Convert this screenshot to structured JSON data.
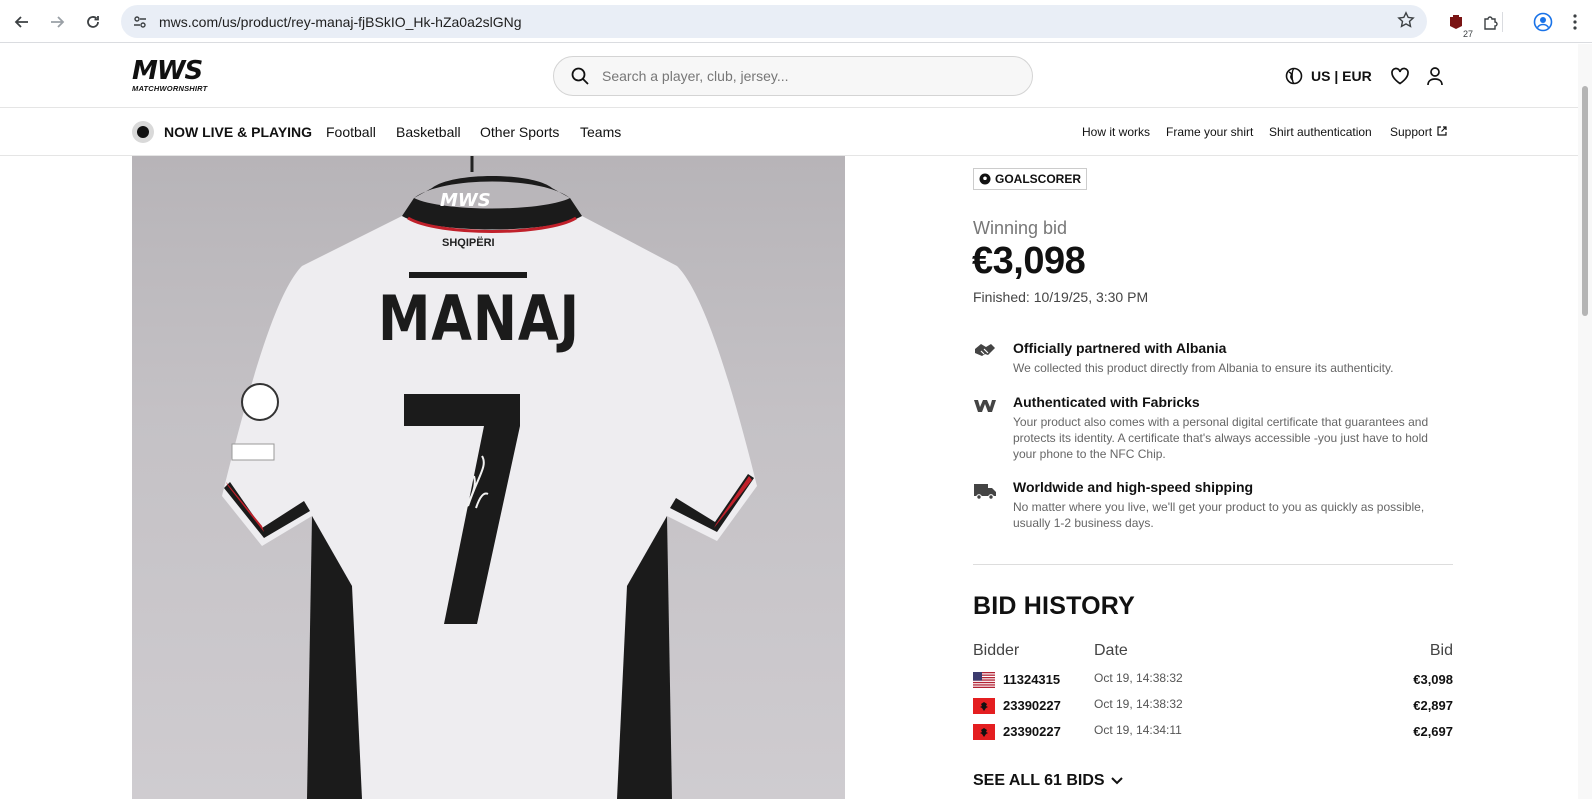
{
  "browser": {
    "url": "mws.com/us/product/rey-manaj-fjBSkIO_Hk-hZa0a2slGNg",
    "extension_badge": "27"
  },
  "header": {
    "logo_text": "MWS",
    "logo_sub": "MATCHWORNSHIRT",
    "search_placeholder": "Search a player, club, jersey...",
    "locale": "US | EUR"
  },
  "subnav": {
    "live_label": "NOW LIVE & PLAYING",
    "categories": [
      "Football",
      "Basketball",
      "Other Sports",
      "Teams"
    ],
    "utility_links": [
      "How it works",
      "Frame your shirt",
      "Shirt authentication",
      "Support"
    ]
  },
  "product": {
    "shirt_brand": "MWS",
    "shirt_country": "SHQIPËRI",
    "shirt_name": "MANAJ",
    "shirt_number": "7"
  },
  "panel": {
    "badge": "GOALSCORER",
    "winning_label": "Winning bid",
    "winning_amount": "€3,098",
    "finished": "Finished: 10/19/25, 3:30 PM",
    "features": [
      {
        "icon": "handshake-icon",
        "title": "Officially partnered with Albania",
        "desc": "We collected this product directly from Albania to ensure its authenticity."
      },
      {
        "icon": "fabricks-icon",
        "title": "Authenticated with Fabricks",
        "desc": "Your product also comes with a personal digital certificate that guarantees and protects its identity. A certificate that's always accessible -you just have to hold your phone to the NFC Chip."
      },
      {
        "icon": "truck-icon",
        "title": "Worldwide and high-speed shipping",
        "desc": "No matter where you live, we'll get your product to you as quickly as possible, usually 1-2 business days."
      }
    ],
    "bid_history": {
      "title": "BID HISTORY",
      "columns": [
        "Bidder",
        "Date",
        "Bid"
      ],
      "rows": [
        {
          "flag": "us-flag-icon",
          "bidder": "11324315",
          "date": "Oct 19, 14:38:32",
          "bid": "€3,098"
        },
        {
          "flag": "albania-flag-icon",
          "bidder": "23390227",
          "date": "Oct 19, 14:38:32",
          "bid": "€2,897"
        },
        {
          "flag": "albania-flag-icon",
          "bidder": "23390227",
          "date": "Oct 19, 14:34:11",
          "bid": "€2,697"
        }
      ],
      "see_all": "SEE ALL 61 BIDS"
    }
  }
}
